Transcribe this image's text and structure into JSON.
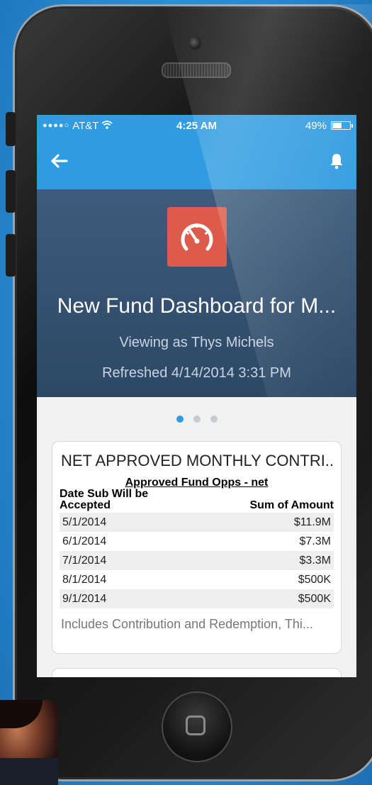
{
  "status_bar": {
    "carrier": "AT&T",
    "time": "4:25 AM",
    "battery_percent": "49%",
    "battery_level": 0.49
  },
  "nav": {
    "back_icon": "arrow-left-icon",
    "notification_icon": "bell-icon"
  },
  "dashboard": {
    "icon": "speedometer-icon",
    "title": "New Fund Dashboard for M...",
    "viewing_as": "Viewing as Thys Michels",
    "refreshed": "Refreshed 4/14/2014 3:31 PM"
  },
  "pager": {
    "page_count": 3,
    "active_index": 0
  },
  "card": {
    "title": "NET APPROVED MONTHLY CONTRI...",
    "subtitle": "Approved Fund Opps - net",
    "col_left": "Date Sub Will be Accepted",
    "col_right": "Sum of Amount",
    "rows": [
      {
        "date": "5/1/2014",
        "amount": "$11.9M"
      },
      {
        "date": "6/1/2014",
        "amount": "$7.3M"
      },
      {
        "date": "7/1/2014",
        "amount": "$3.3M"
      },
      {
        "date": "8/1/2014",
        "amount": "$500K"
      },
      {
        "date": "9/1/2014",
        "amount": "$500K"
      }
    ],
    "footnote": "Includes Contribution and Redemption, Thi..."
  },
  "colors": {
    "accent": "#2f9be0",
    "hero": "#34506f",
    "app_icon": "#dc5b4a"
  }
}
